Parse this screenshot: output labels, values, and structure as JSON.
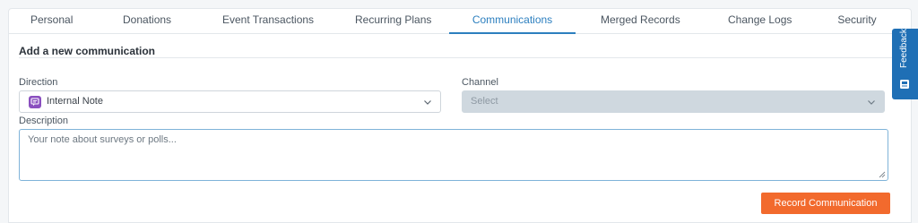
{
  "tabs": [
    {
      "label": "Personal"
    },
    {
      "label": "Donations"
    },
    {
      "label": "Event Transactions"
    },
    {
      "label": "Recurring Plans"
    },
    {
      "label": "Communications",
      "active": true
    },
    {
      "label": "Merged Records"
    },
    {
      "label": "Change Logs"
    },
    {
      "label": "Security"
    }
  ],
  "form": {
    "section_title": "Add a new communication",
    "direction": {
      "label": "Direction",
      "value": "Internal Note",
      "icon": "note-icon"
    },
    "channel": {
      "label": "Channel",
      "placeholder": "Select",
      "disabled": true
    },
    "description": {
      "label": "Description",
      "placeholder": "Your note about surveys or polls..."
    },
    "submit_label": "Record Communication"
  },
  "feedback": {
    "label": "Feedback"
  },
  "colors": {
    "accent": "#2c7fbf",
    "primary_button": "#f26a2d",
    "feedback_tab": "#1f6fb5",
    "note_icon": "#8a4fbf"
  }
}
